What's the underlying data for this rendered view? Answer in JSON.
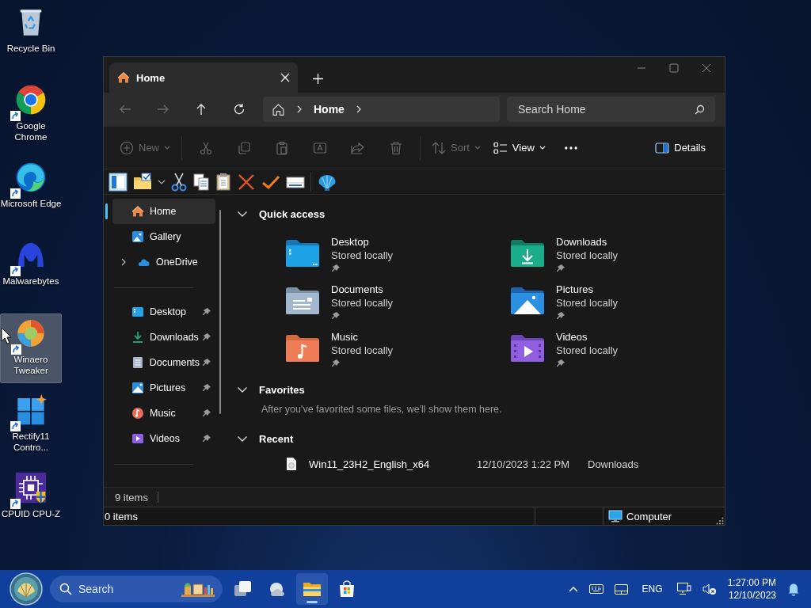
{
  "desktop_icons": [
    {
      "label": "Recycle Bin",
      "kind": "recyclebin",
      "shortcut": false,
      "selected": false
    },
    {
      "label": "Google Chrome",
      "kind": "chrome",
      "shortcut": true,
      "selected": false
    },
    {
      "label": "Microsoft Edge",
      "kind": "edge",
      "shortcut": true,
      "selected": false
    },
    {
      "label": "Malwarebytes",
      "kind": "malwarebytes",
      "shortcut": true,
      "selected": false
    },
    {
      "label": "Winaero Tweaker",
      "kind": "winaero",
      "shortcut": true,
      "selected": true
    },
    {
      "label": "Rectify11 Contro...",
      "kind": "rectify",
      "shortcut": true,
      "selected": false
    },
    {
      "label": "CPUID CPU-Z",
      "kind": "cpuz",
      "shortcut": true,
      "selected": false
    }
  ],
  "window": {
    "tabs": [
      {
        "label": "Home",
        "selected": true
      }
    ],
    "breadcrumb": [
      "Home"
    ],
    "search": {
      "placeholder": "Search Home"
    },
    "command_bar": [
      {
        "kind": "new",
        "label": "New",
        "disabled": true,
        "dropdown": true
      },
      {
        "kind": "cut",
        "disabled": true,
        "dropdown": false
      },
      {
        "kind": "copy",
        "disabled": true,
        "dropdown": false
      },
      {
        "kind": "paste",
        "disabled": true,
        "dropdown": false
      },
      {
        "kind": "rename",
        "disabled": true,
        "dropdown": false
      },
      {
        "kind": "share",
        "disabled": true,
        "dropdown": false
      },
      {
        "kind": "delete",
        "disabled": true,
        "dropdown": false
      },
      {
        "kind": "sort",
        "label": "Sort",
        "disabled": true,
        "dropdown": true
      },
      {
        "kind": "view",
        "label": "View",
        "disabled": false,
        "dropdown": true
      },
      {
        "kind": "more",
        "disabled": false,
        "dropdown": false
      }
    ],
    "details_button": {
      "label": "Details"
    },
    "nav_pane": {
      "groups": [
        [
          {
            "label": "Home",
            "kind": "home",
            "selected": true,
            "expandable": false,
            "pinned": false
          },
          {
            "label": "Gallery",
            "kind": "gallery",
            "selected": false,
            "expandable": false,
            "pinned": false
          },
          {
            "label": "OneDrive",
            "kind": "cloud",
            "selected": false,
            "expandable": true,
            "pinned": false
          }
        ],
        [
          {
            "label": "Desktop",
            "kind": "desktop",
            "selected": false,
            "expandable": false,
            "pinned": true
          },
          {
            "label": "Downloads",
            "kind": "downloads",
            "selected": false,
            "expandable": false,
            "pinned": true
          },
          {
            "label": "Documents",
            "kind": "documents",
            "selected": false,
            "expandable": false,
            "pinned": true
          },
          {
            "label": "Pictures",
            "kind": "pictures",
            "selected": false,
            "expandable": false,
            "pinned": true
          },
          {
            "label": "Music",
            "kind": "music",
            "selected": false,
            "expandable": false,
            "pinned": true
          },
          {
            "label": "Videos",
            "kind": "videos",
            "selected": false,
            "expandable": false,
            "pinned": true
          }
        ]
      ]
    },
    "sections": [
      {
        "title": "Quick access",
        "kind": "tiles",
        "expanded": true,
        "items": [
          {
            "name": "Desktop",
            "status": "Stored locally",
            "kind": "desktop",
            "pinned": true
          },
          {
            "name": "Downloads",
            "status": "Stored locally",
            "kind": "downloads",
            "pinned": true
          },
          {
            "name": "Documents",
            "status": "Stored locally",
            "kind": "documents",
            "pinned": true
          },
          {
            "name": "Pictures",
            "status": "Stored locally",
            "kind": "pictures",
            "pinned": true
          },
          {
            "name": "Music",
            "status": "Stored locally",
            "kind": "music",
            "pinned": true
          },
          {
            "name": "Videos",
            "status": "Stored locally",
            "kind": "videos",
            "pinned": true
          }
        ]
      },
      {
        "title": "Favorites",
        "kind": "message",
        "expanded": true,
        "text": "After you've favorited some files, we'll show them here."
      },
      {
        "title": "Recent",
        "kind": "files",
        "expanded": true,
        "items": [
          {
            "name": "Win11_23H2_English_x64",
            "date": "12/10/2023 1:22 PM",
            "location": "Downloads"
          }
        ]
      }
    ],
    "status_bar": {
      "count": "9 items"
    },
    "classic_status_bar": {
      "count": "0 items",
      "location": "Computer"
    }
  },
  "taskbar": {
    "search": {
      "placeholder": "Search"
    },
    "apps": [
      {
        "kind": "taskview",
        "active": false
      },
      {
        "kind": "weather",
        "active": false
      },
      {
        "kind": "explorer",
        "active": true
      },
      {
        "kind": "store",
        "active": false
      }
    ],
    "language": "ENG",
    "time": "1:27:00 PM",
    "date": "12/10/2023"
  }
}
